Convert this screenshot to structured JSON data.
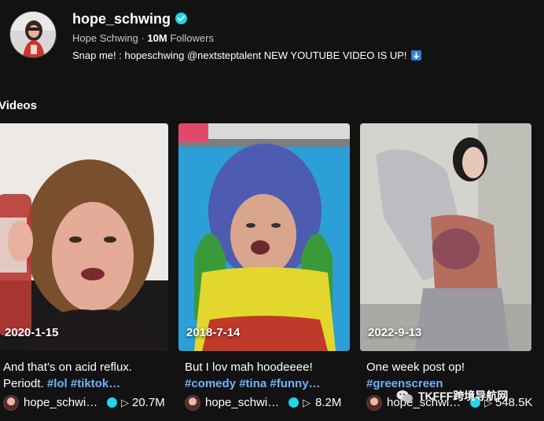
{
  "profile": {
    "username": "hope_schwing",
    "display_name": "Hope Schwing",
    "followers_count": "10M",
    "followers_label": "Followers",
    "bio": "Snap me! : hopeschwing @nextsteptalent NEW YOUTUBE VIDEO IS UP!"
  },
  "section_title": "Videos",
  "videos": [
    {
      "date": "2020-1-15",
      "caption_text": "And that’s on acid reflux. Periodt.",
      "tags": "#lol #tiktok…",
      "author": "hope_schwi…",
      "views": "20.7M"
    },
    {
      "date": "2018-7-14",
      "caption_text": "But I lov mah hoodeeee!",
      "tags": "#comedy #tina #funny…",
      "author": "hope_schwi…",
      "views": "8.2M"
    },
    {
      "date": "2022-9-13",
      "caption_text": "One week post op!",
      "tags": "#greenscreen",
      "author": "hope_schwi…",
      "views": "548.5K"
    }
  ],
  "watermark": "TKFFF跨境导航网",
  "colors": {
    "background": "#121212",
    "verified": "#20d5ec",
    "hashtag": "#6fb3ff"
  },
  "icons": [
    "verified-icon",
    "down-arrow-icon",
    "play-icon",
    "wechat-icon"
  ]
}
